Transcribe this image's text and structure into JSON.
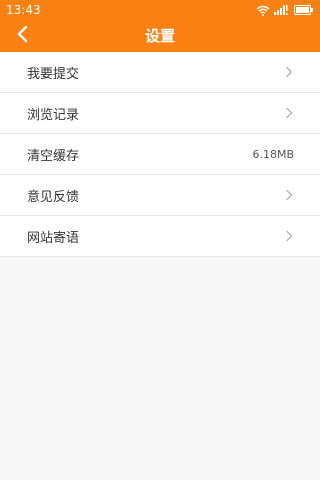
{
  "status_bar": {
    "time": "13:43",
    "icons": [
      "wifi-icon",
      "signal-icon",
      "battery-icon"
    ]
  },
  "header": {
    "title": "设置",
    "back_icon": "chevron-left-icon"
  },
  "settings": {
    "items": [
      {
        "label": "我要提交",
        "value": "",
        "icon": "chevron-right-icon"
      },
      {
        "label": "浏览记录",
        "value": "",
        "icon": "chevron-right-icon"
      },
      {
        "label": "清空缓存",
        "value": "6.18MB",
        "icon": ""
      },
      {
        "label": "意见反馈",
        "value": "",
        "icon": "chevron-right-icon"
      },
      {
        "label": "网站寄语",
        "value": "",
        "icon": "chevron-right-icon"
      }
    ]
  },
  "colors": {
    "accent": "#fb8113",
    "background": "#f7f7f7",
    "row_background": "#ffffff",
    "divider": "#e6e6e6",
    "text": "#333333"
  }
}
